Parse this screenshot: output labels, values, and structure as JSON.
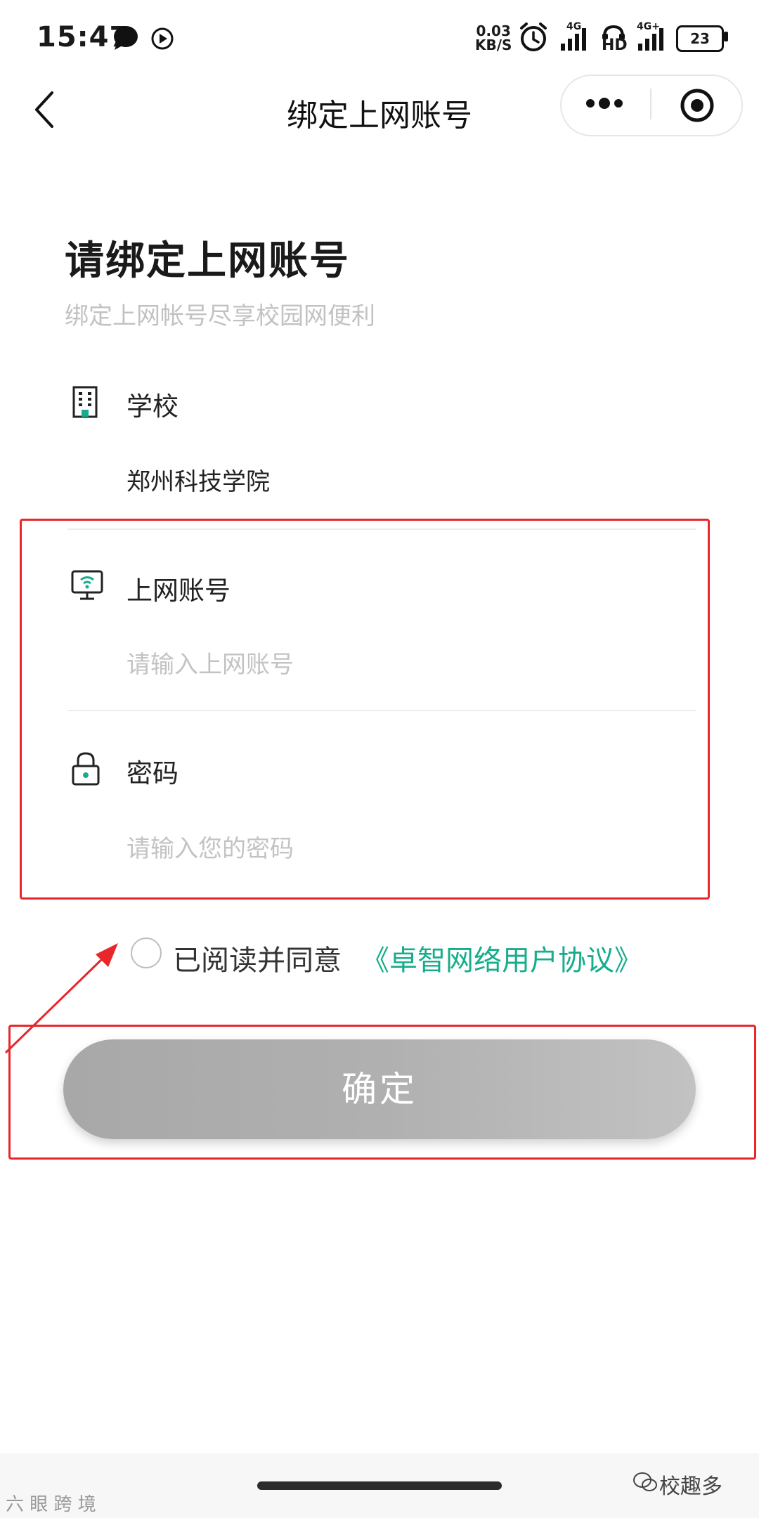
{
  "status_bar": {
    "time": "15:47",
    "net_speed_value": "0.03",
    "net_speed_unit": "KB/S",
    "signal1_label": "4G",
    "hd_label": "HD",
    "signal2_label": "4G+",
    "battery_level": "23",
    "icons": [
      "chat-bubble-icon",
      "play-icon",
      "alarm-icon",
      "signal-icon",
      "hd-call-icon",
      "signal-icon",
      "battery-icon"
    ]
  },
  "nav": {
    "title": "绑定上网账号",
    "back_icon": "chevron-left-icon",
    "more_icon": "more-dots-icon",
    "close_icon": "target-close-icon"
  },
  "header": {
    "title": "请绑定上网账号",
    "subtitle": "绑定上网帐号尽享校园网便利"
  },
  "form": {
    "school": {
      "label": "学校",
      "value": "郑州科技学院",
      "icon": "building-icon"
    },
    "account": {
      "label": "上网账号",
      "placeholder": "请输入上网账号",
      "icon": "monitor-wifi-icon"
    },
    "password": {
      "label": "密码",
      "placeholder": "请输入您的密码",
      "icon": "lock-icon"
    }
  },
  "agreement": {
    "text": "已阅读并同意",
    "link": "《卓智网络用户协议》"
  },
  "confirm_button": {
    "label": "确定"
  },
  "watermarks": {
    "left": "六 眼 跨 境",
    "right": "校趣多"
  },
  "colors": {
    "accent": "#17ad8c",
    "annotation_red": "#e8262b",
    "button_gray": "#b0b0b0"
  }
}
